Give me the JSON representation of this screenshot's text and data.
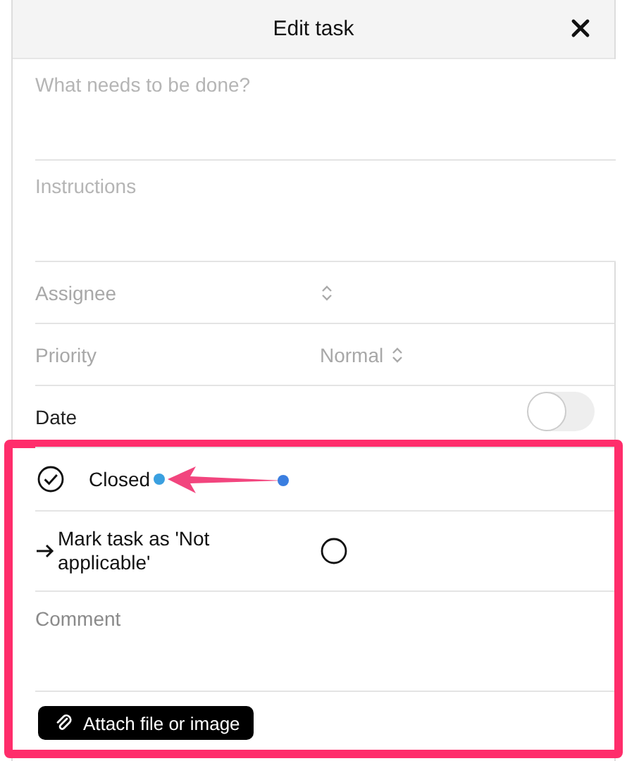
{
  "header": {
    "title": "Edit task"
  },
  "fields": [
    {
      "kind": "textarea",
      "placeholder": "What needs to be done?"
    },
    {
      "kind": "textarea",
      "placeholder": "Instructions"
    },
    {
      "kind": "picker",
      "label": "Assignee"
    },
    {
      "kind": "picker",
      "label": "Priority",
      "value": "Normal"
    },
    {
      "kind": "toggle",
      "label": "Date",
      "on": false
    }
  ],
  "highlight": {
    "status_options": [
      {
        "kind": "check",
        "label": "Closed",
        "checked": true
      },
      {
        "kind": "radio",
        "label": "Mark task as 'Not applicable'",
        "checked": false
      }
    ],
    "comment": {
      "placeholder": "Comment"
    },
    "attach_button": {
      "label": "Attach file or image"
    }
  }
}
